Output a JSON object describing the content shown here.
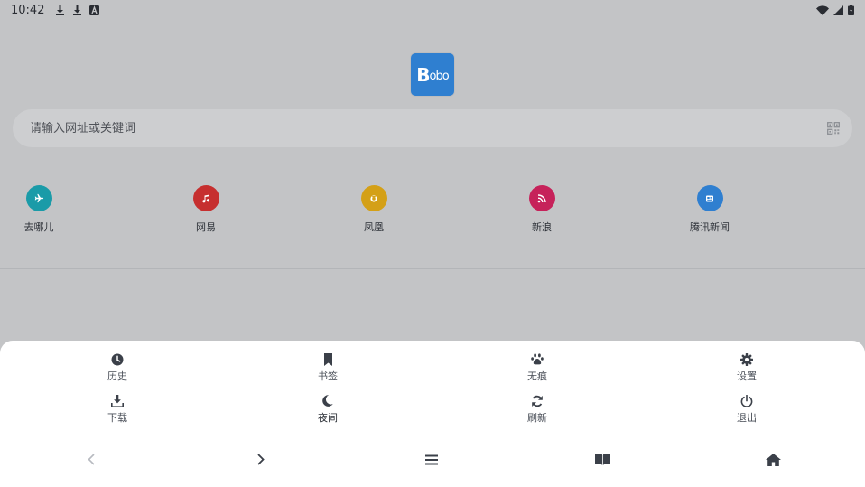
{
  "status_bar": {
    "time": "10:42",
    "left_icons": [
      "download-icon",
      "download-icon",
      "text-a-icon"
    ],
    "right_icons": [
      "wifi-icon",
      "signal-icon",
      "battery-icon"
    ]
  },
  "logo": {
    "text_big": "B",
    "text_small": "obo"
  },
  "search": {
    "placeholder": "请输入网址或关键词",
    "value": "",
    "right_icon": "qr-code-icon"
  },
  "shortcuts": [
    {
      "label": "去哪儿",
      "icon": "airplane-icon",
      "color": "#1a9ba8"
    },
    {
      "label": "网易",
      "icon": "music-note-icon",
      "color": "#c62f2f"
    },
    {
      "label": "凤凰",
      "icon": "phoenix-icon",
      "color": "#d4a017"
    },
    {
      "label": "新浪",
      "icon": "rss-icon",
      "color": "#c6225a"
    },
    {
      "label": "腾讯新闻",
      "icon": "news-icon",
      "color": "#2f7fd0"
    }
  ],
  "menu": {
    "items": [
      {
        "label": "历史",
        "icon": "clock-icon"
      },
      {
        "label": "书签",
        "icon": "bookmark-icon"
      },
      {
        "label": "无痕",
        "icon": "paw-icon"
      },
      {
        "label": "设置",
        "icon": "gear-icon"
      },
      {
        "label": "下载",
        "icon": "download-icon"
      },
      {
        "label": "夜间",
        "icon": "moon-icon"
      },
      {
        "label": "刷新",
        "icon": "refresh-icon"
      },
      {
        "label": "退出",
        "icon": "power-icon"
      }
    ]
  },
  "toolbar": {
    "buttons": [
      "back-icon",
      "forward-icon",
      "menu-icon",
      "book-icon",
      "home-icon"
    ]
  },
  "colors": {
    "background": "#c3c4c6",
    "logo": "#2f7fd0",
    "sheet": "#ffffff",
    "icon": "#3b4049"
  }
}
